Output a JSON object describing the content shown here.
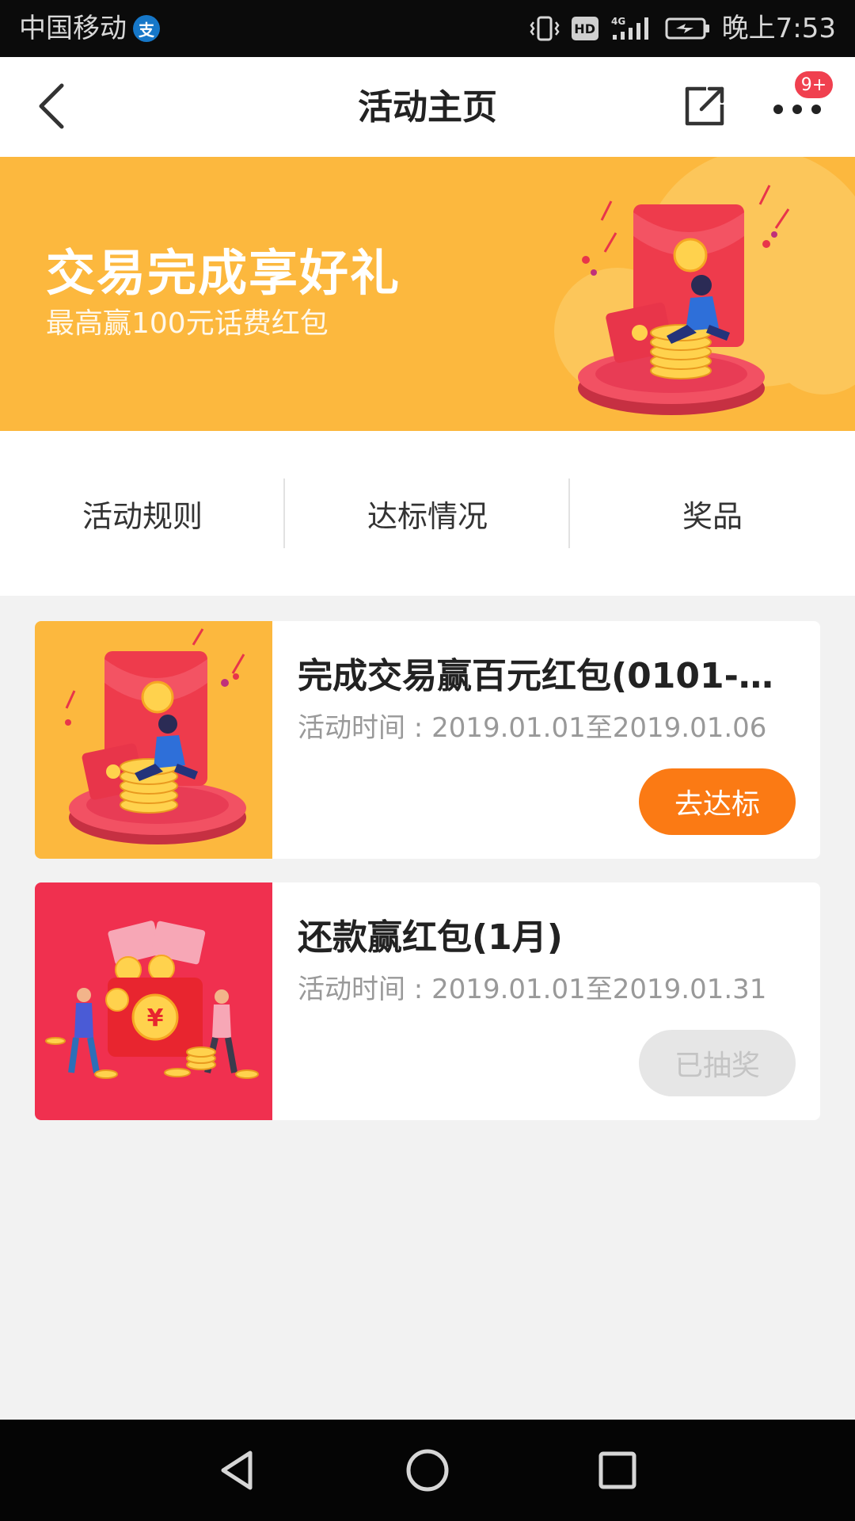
{
  "status_bar": {
    "carrier": "中国移动",
    "alipay_glyph": "支",
    "hd_label": "HD",
    "network_label": "4G",
    "time": "晚上7:53"
  },
  "nav": {
    "title": "活动主页",
    "badge": "9+",
    "icons": [
      "chevron-left-icon",
      "share-icon",
      "more-dots-icon"
    ]
  },
  "banner": {
    "title": "交易完成享好礼",
    "subtitle": "最高赢100元话费红包"
  },
  "tabs": [
    {
      "label": "活动规则"
    },
    {
      "label": "达标情况"
    },
    {
      "label": "奖品"
    }
  ],
  "activities": [
    {
      "title": "完成交易赢百元红包(0101-0...",
      "time": "活动时间 : 2019.01.01至2019.01.06",
      "button": "去达标",
      "button_state": "active"
    },
    {
      "title": "还款赢红包(1月)",
      "time": "活动时间 : 2019.01.01至2019.01.31",
      "button": "已抽奖",
      "button_state": "disabled"
    }
  ],
  "colors": {
    "banner_bg": "#fcb83e",
    "accent_orange": "#fb7a14",
    "badge_red": "#f0404f",
    "page_bg": "#f2f2f2"
  }
}
